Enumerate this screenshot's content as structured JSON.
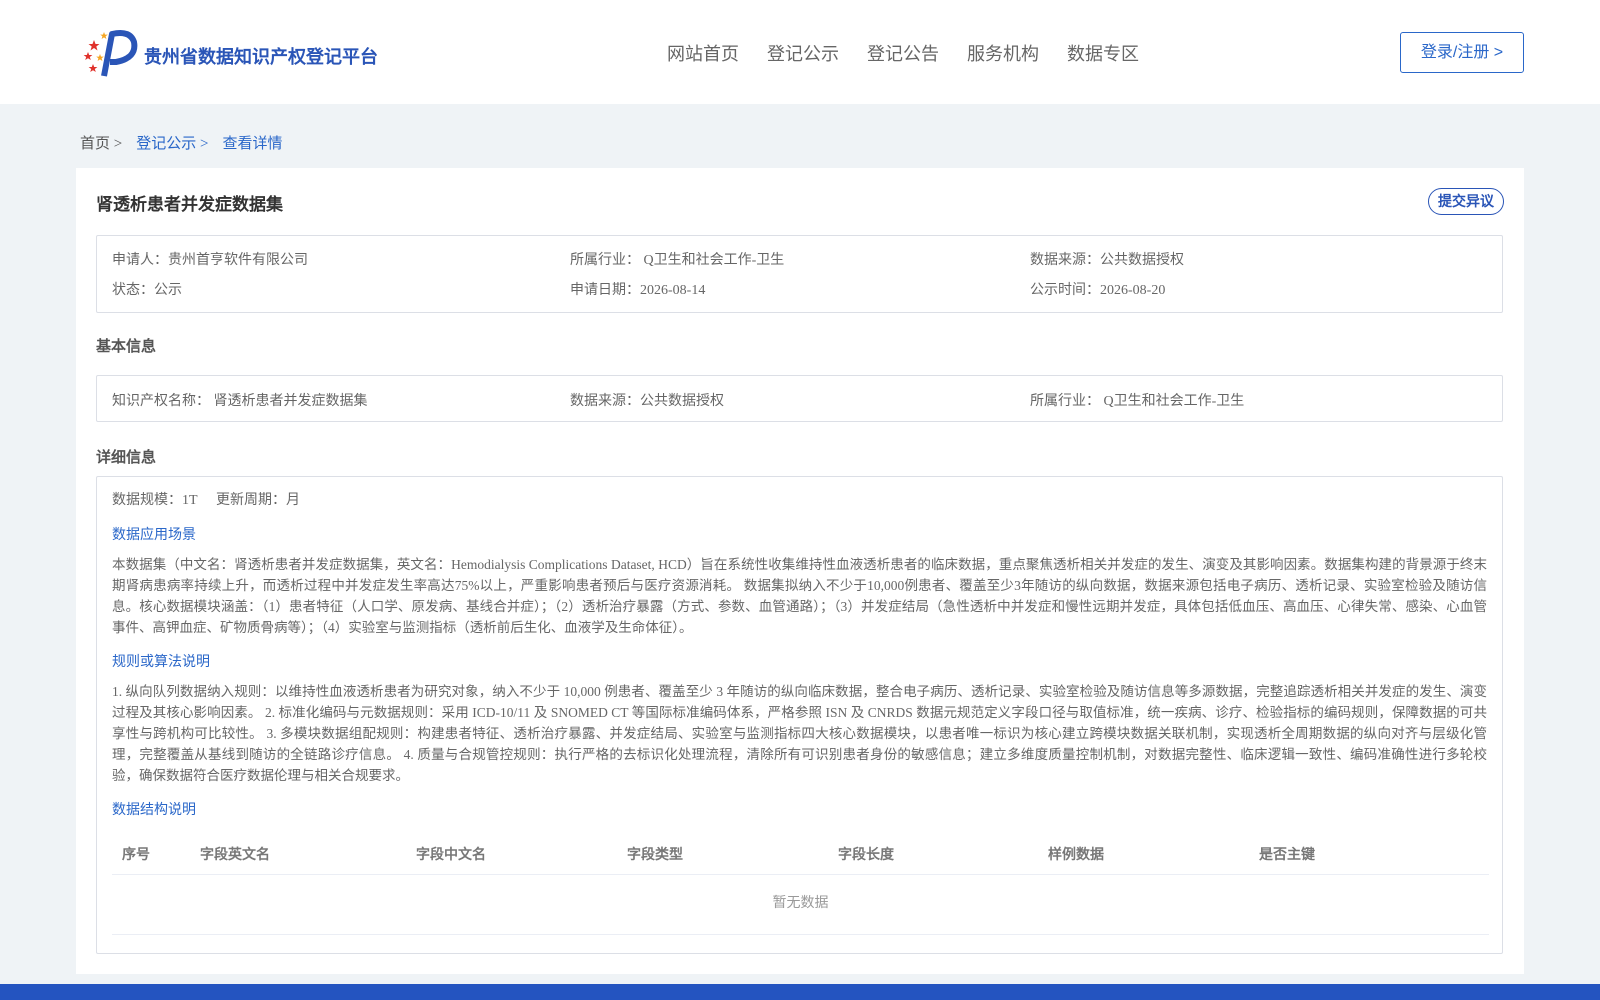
{
  "header": {
    "brand": "贵州省数据知识产权登记平台",
    "nav": [
      "网站首页",
      "登记公示",
      "登记公告",
      "服务机构",
      "数据专区"
    ],
    "login": "登录/注册 >"
  },
  "breadcrumb": [
    "首页 >",
    "登记公示 >",
    "查看详情"
  ],
  "record": {
    "title": "肾透析患者并发症数据集",
    "objection": "提交异议",
    "summary": {
      "applicant": "申请人：贵州首亨软件有限公司",
      "industry": "所属行业： Q卫生和社会工作-卫生",
      "source": "数据来源：公共数据授权",
      "status": "状态：公示",
      "apply_date": "申请日期：2026-08-14",
      "publish_date": "公示时间：2026-08-20"
    }
  },
  "basic": {
    "heading": "基本信息",
    "ip_name": "知识产权名称： 肾透析患者并发症数据集",
    "source": "数据来源：公共数据授权",
    "industry": "所属行业： Q卫生和社会工作-卫生"
  },
  "detail": {
    "heading": "详细信息",
    "scale": "数据规模：1T",
    "cycle": "更新周期：月",
    "scenario_title": "数据应用场景",
    "scenario_text": "本数据集（中文名：肾透析患者并发症数据集，英文名：Hemodialysis Complications Dataset, HCD）旨在系统性收集维持性血液透析患者的临床数据，重点聚焦透析相关并发症的发生、演变及其影响因素。数据集构建的背景源于终末期肾病患病率持续上升，而透析过程中并发症发生率高达75%以上，严重影响患者预后与医疗资源消耗。 数据集拟纳入不少于10,000例患者、覆盖至少3年随访的纵向数据，数据来源包括电子病历、透析记录、实验室检验及随访信息。核心数据模块涵盖：（1）患者特征（人口学、原发病、基线合并症）；（2）透析治疗暴露（方式、参数、血管通路）；（3）并发症结局（急性透析中并发症和慢性远期并发症，具体包括低血压、高血压、心律失常、感染、心血管事件、高钾血症、矿物质骨病等）；（4）实验室与监测指标（透析前后生化、血液学及生命体征）。",
    "rules_title": "规则或算法说明",
    "rules_text": "1. 纵向队列数据纳入规则：以维持性血液透析患者为研究对象，纳入不少于 10,000 例患者、覆盖至少 3 年随访的纵向临床数据，整合电子病历、透析记录、实验室检验及随访信息等多源数据，完整追踪透析相关并发症的发生、演变过程及其核心影响因素。 2. 标准化编码与元数据规则：采用 ICD-10/11 及 SNOMED CT 等国际标准编码体系，严格参照 ISN 及 CNRDS 数据元规范定义字段口径与取值标准，统一疾病、诊疗、检验指标的编码规则，保障数据的可共享性与跨机构可比较性。 3. 多模块数据组配规则：构建患者特征、透析治疗暴露、并发症结局、实验室与监测指标四大核心数据模块，以患者唯一标识为核心建立跨模块数据关联机制，实现透析全周期数据的纵向对齐与层级化管理，完整覆盖从基线到随访的全链路诊疗信息。 4. 质量与合规管控规则：执行严格的去标识化处理流程，清除所有可识别患者身份的敏感信息；建立多维度质量控制机制，对数据完整性、临床逻辑一致性、编码准确性进行多轮校验，确保数据符合医疗数据伦理与相关合规要求。",
    "structure_title": "数据结构说明",
    "columns": [
      "序号",
      "字段英文名",
      "字段中文名",
      "字段类型",
      "字段长度",
      "样例数据",
      "是否主键"
    ],
    "empty": "暂无数据"
  },
  "colors": {
    "primary": "#2a67c9",
    "brand": "#2a55b7",
    "footer": "#2454c0",
    "background": "#eff3f6"
  }
}
